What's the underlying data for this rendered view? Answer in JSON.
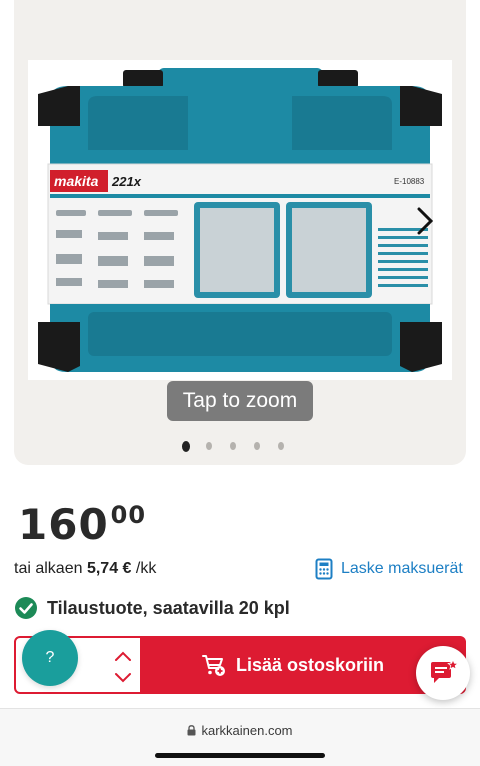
{
  "gallery": {
    "image_alt": "Makita 221x tool set case",
    "brand": "makita",
    "set_size": "221x",
    "model_code": "E-10883",
    "zoom_label": "Tap to zoom",
    "dots_count": 5,
    "active_dot": 0
  },
  "price": {
    "main": "160",
    "cents": "00"
  },
  "installment": {
    "prefix": "tai alkaen",
    "amount": "5,74 €",
    "suffix": "/kk",
    "calc_label": "Laske maksuerät"
  },
  "availability": {
    "text": "Tilaustuote, saatavilla 20 kpl"
  },
  "cart": {
    "quantity": "",
    "add_label": "Lisää ostoskoriin"
  },
  "help": {
    "label": "?"
  },
  "browser": {
    "url": "karkkainen.com"
  },
  "colors": {
    "accent_red": "#dd1b32",
    "link_blue": "#1d7fc4",
    "check_green": "#1c8a57",
    "help_teal": "#1a9e9c",
    "case_teal": "#1d8aa4"
  }
}
